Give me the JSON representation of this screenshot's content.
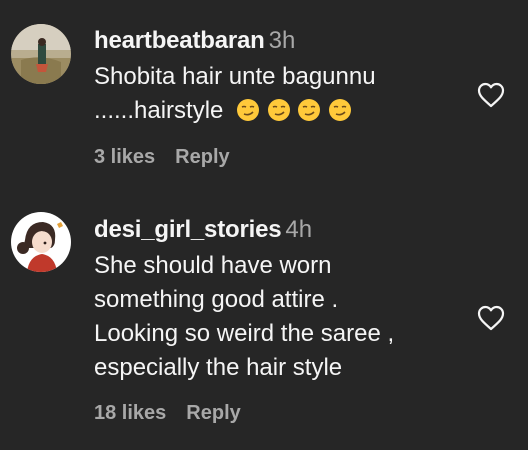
{
  "comments": [
    {
      "username": "heartbeatbaran",
      "time": "3h",
      "text_lines": [
        "Shobita hair unte bagunnu",
        "......hairstyle"
      ],
      "emoji": "😏😏😏😏",
      "likes": "3 likes",
      "reply": "Reply"
    },
    {
      "username": "desi_girl_stories",
      "time": "4h",
      "text_lines": [
        "She should have worn",
        "something good attire .",
        "Looking so weird the saree ,",
        "especially the hair style"
      ],
      "likes": "18 likes",
      "reply": "Reply"
    }
  ],
  "icons": {
    "like": "heart-outline-icon",
    "emoji": "smirking-face-emoji"
  },
  "colors": {
    "background": "#262626",
    "primary_text": "#f5f5f5",
    "secondary_text": "#a8a8a8"
  }
}
